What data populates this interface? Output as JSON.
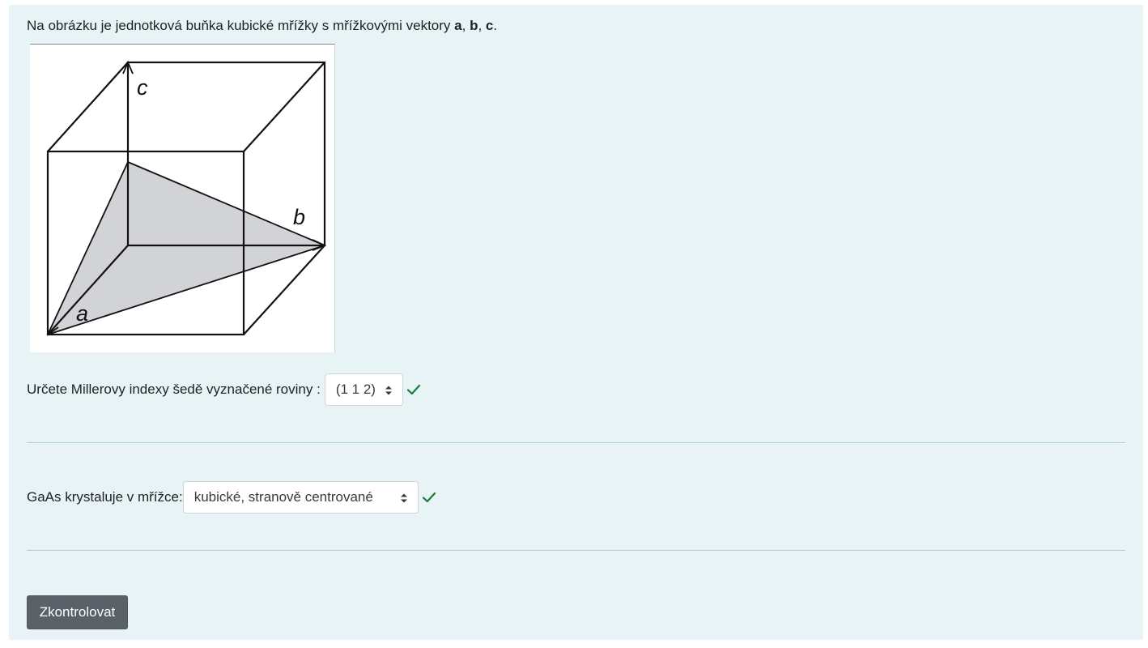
{
  "question": {
    "intro_text": "Na obrázku je jednotková buňka kubické mřížky s mřížkovými vektory ",
    "vec_a": "a",
    "sep1": ", ",
    "vec_b": "b",
    "sep2": ", ",
    "vec_c": "c",
    "end": "."
  },
  "figure": {
    "label_a": "a",
    "label_b": "b",
    "label_c": "c",
    "plane_color": "#d1d3d6",
    "line_color": "#111111"
  },
  "q1": {
    "label": "Určete Millerovy indexy šedě vyznačené roviny :",
    "selected": "(1 1 2)",
    "status_icon": "check-icon",
    "status_color": "#1a7a3c"
  },
  "q2": {
    "label": "GaAs krystaluje v mřížce:",
    "selected": "kubické, stranově centrované",
    "status_icon": "check-icon",
    "status_color": "#1a7a3c"
  },
  "actions": {
    "check_label": "Zkontrolovat"
  },
  "colors": {
    "panel_bg": "#e7f3f5",
    "divider": "#a9d2da",
    "button_bg": "#5b6168"
  }
}
